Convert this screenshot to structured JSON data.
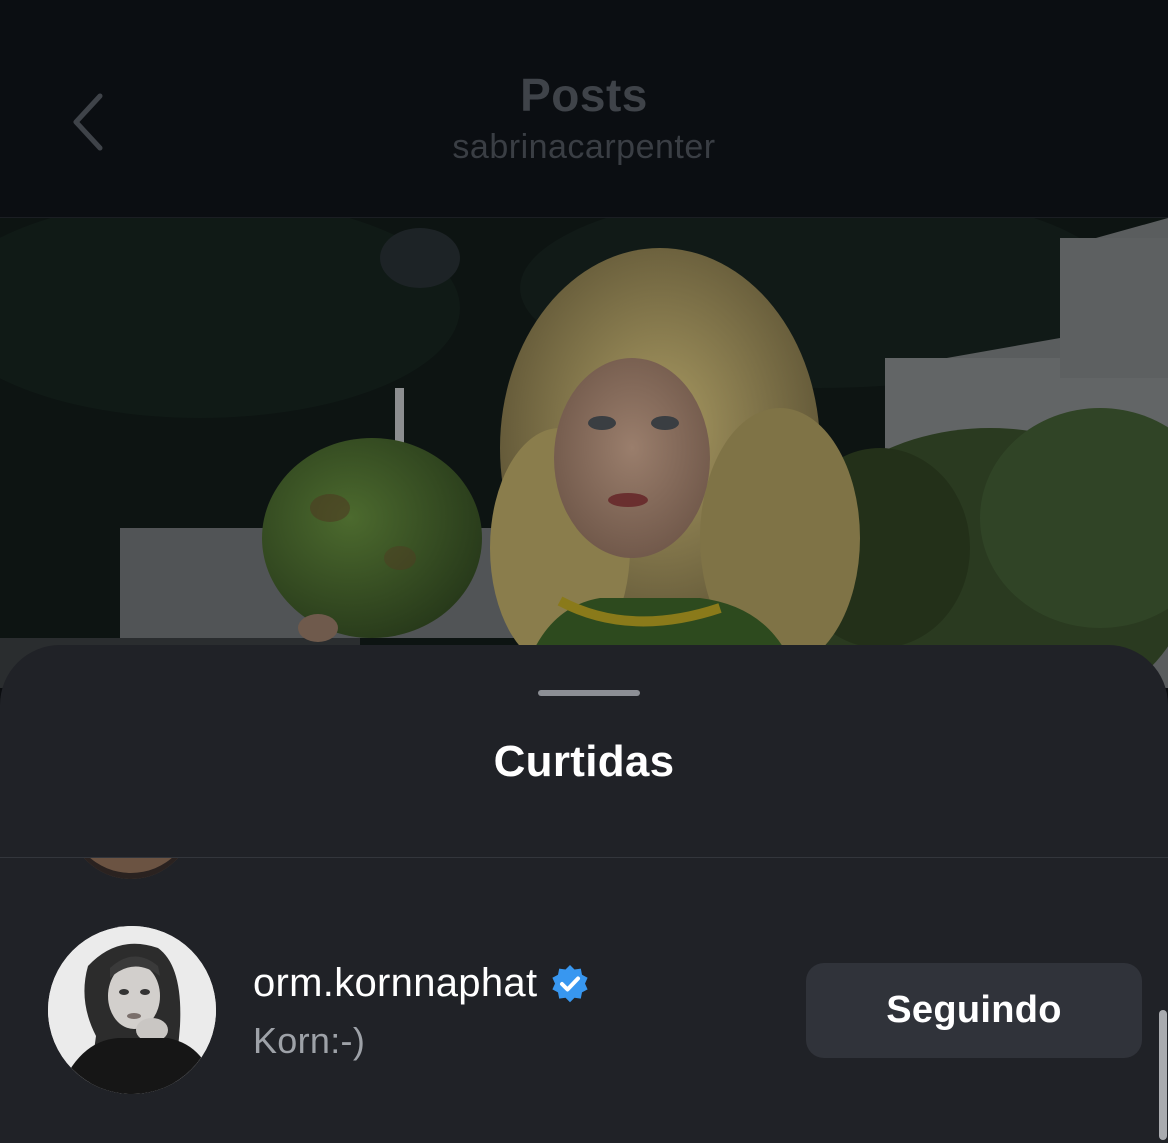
{
  "header": {
    "title": "Posts",
    "subtitle": "sabrinacarpenter",
    "back_icon": "chevron-left-icon"
  },
  "post": {
    "image_description": "photo"
  },
  "sheet": {
    "title": "Curtidas"
  },
  "likes": [
    {
      "username": "orm.kornnaphat",
      "verified": true,
      "full_name": "Korn:-)",
      "follow_label": "Seguindo"
    }
  ],
  "colors": {
    "background": "#0b0d10",
    "sheet": "#202227",
    "button": "#30333a",
    "verified": "#3897f0"
  }
}
